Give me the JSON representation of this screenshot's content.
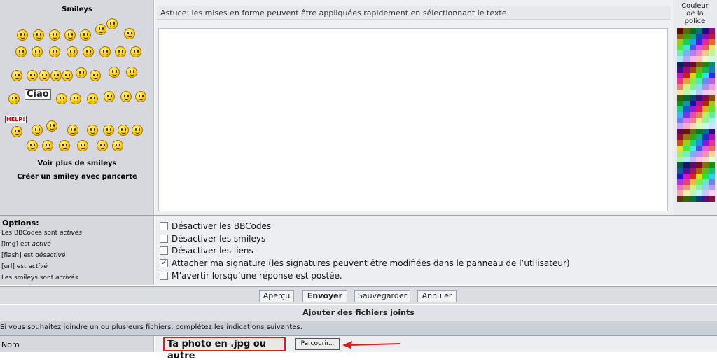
{
  "smileys_panel": {
    "title": "Smileys",
    "more_link": "Voir plus de smileys",
    "create_link": "Créer un smiley avec pancarte",
    "help_sign": "HELP!",
    "ciao_sign": "Ciao"
  },
  "editor": {
    "tip": "Astuce: les mises en forme peuvent être appliquées rapidement en sélectionnant le texte.",
    "message": ""
  },
  "color_panel": {
    "title_line1": "Couleur",
    "title_line2": "de la",
    "title_line3": "police"
  },
  "options": {
    "title": "Options:",
    "bbcode_status": "Les BBCodes sont ",
    "bbcode_value": "activés",
    "img_status": "[img] est ",
    "img_value": "activé",
    "flash_status": "[flash] est ",
    "flash_value": "désactivé",
    "url_status": "[url] est ",
    "url_value": "activé",
    "smileys_status": "Les smileys sont ",
    "smileys_value": "activés",
    "checkboxes": [
      {
        "label": "Désactiver les BBCodes",
        "checked": false
      },
      {
        "label": "Désactiver les smileys",
        "checked": false
      },
      {
        "label": "Désactiver les liens",
        "checked": false
      },
      {
        "label": "Attacher ma signature (les signatures peuvent être modifiées dans le panneau de l’utilisateur)",
        "checked": true
      },
      {
        "label": "M’avertir lorsqu’une réponse est postée.",
        "checked": false
      }
    ]
  },
  "buttons": {
    "preview": "Aperçu",
    "submit": "Envoyer",
    "save": "Sauvegarder",
    "cancel": "Annuler"
  },
  "attachments": {
    "header": "Ajouter des fichiers joints",
    "info": "Si vous souhaitez joindre un ou plusieurs fichiers, complétez les indications suivantes.",
    "name_label": "Nom",
    "annotation": "Ta photo en .jpg ou autre",
    "browse": "Parcourir..."
  },
  "colors": {
    "annotation_red": "#cc2222"
  }
}
